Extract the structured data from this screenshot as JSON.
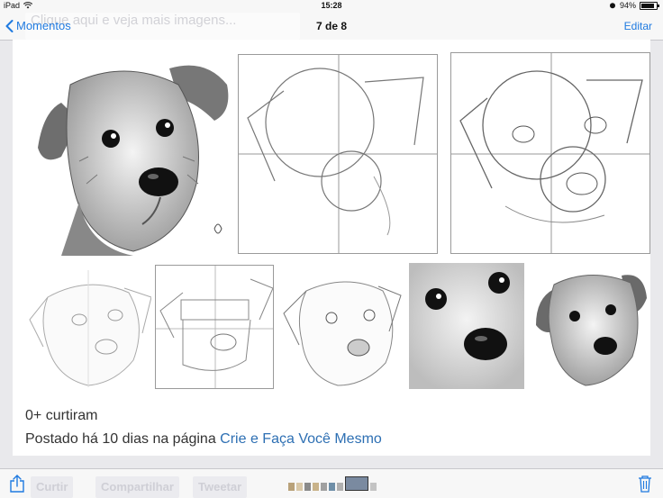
{
  "status_bar": {
    "device": "iPad",
    "time": "15:28",
    "battery": "94%"
  },
  "nav": {
    "back_label": "Momentos",
    "title": "7 de 8",
    "edit_label": "Editar",
    "ghost_text": "Clique aqui e veja mais imagens..."
  },
  "post": {
    "likes": "0+ curtiram",
    "posted_prefix": "Postado há 10 dias na página ",
    "page_link": "Crie e Faça Você Mesmo"
  },
  "toolbar": {
    "ghost_curtir": "Curtir",
    "ghost_compartilhar": "Compartilhar",
    "ghost_tweetar": "Tweetar"
  },
  "colors": {
    "accent": "#1f7ae0",
    "link": "#2d6fb3"
  }
}
